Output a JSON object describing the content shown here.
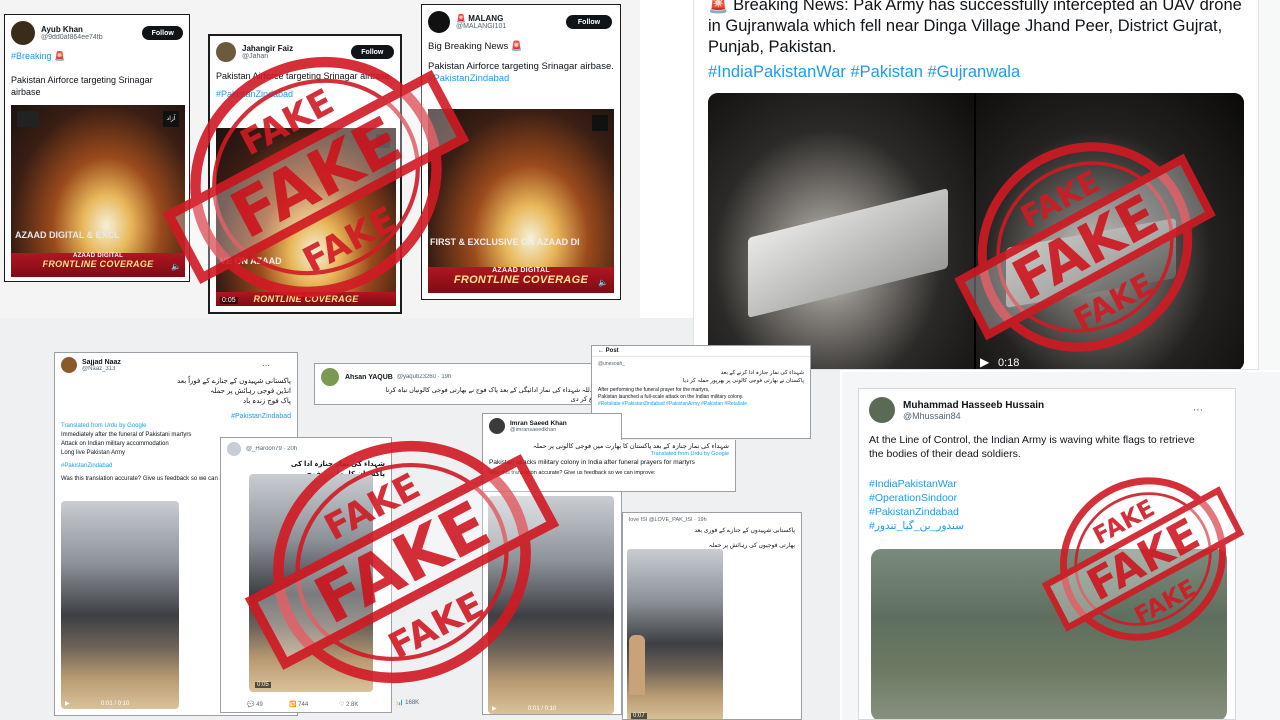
{
  "stamp": {
    "text": "FAKE",
    "color": "#d11a24"
  },
  "colors": {
    "hashtag": "#1d9bf0",
    "text": "#0f1419",
    "muted": "#536471",
    "banner": "#b01622"
  },
  "tweet_ayub": {
    "name": "Ayub Khan",
    "handle": "@9dd0af864ee74fb",
    "follow": "Follow",
    "tag": "#Breaking",
    "emoji": "🚨",
    "text": "Pakistan Airforce targeting Srinagar airbase",
    "banner_title": "AZAAD DIGITAL",
    "banner_sub": "FRONTLINE COVERAGE",
    "overlay": "AZAAD DIGITAL  & EXCL"
  },
  "tweet_jahangir": {
    "name": "Jahangir Faiz",
    "handle": "@Jahan",
    "follow": "Follow",
    "text": "Pakistan Airforce targeting Srinagar airbase.",
    "tag": "#PakistanZindabad",
    "overlay": "VE ON AZAAD",
    "banner_sub": "RONTLINE COVERAGE",
    "time": "0:05"
  },
  "tweet_malang": {
    "name": "MALANG",
    "handle": "@MALANGI101",
    "follow": "Follow",
    "text1": "Big Breaking News",
    "emoji": "🚨",
    "text2": "Pakistan Airforce targeting Srinagar airbase.",
    "tag": "#PakistanZindabad",
    "overlay": "FIRST & EXCLUSIVE ON AZAAD DI",
    "banner_title": "AZAAD DIGITAL",
    "banner_sub": "FRONTLINE COVERAGE"
  },
  "tweet_pakarmy": {
    "line1": "🚨 Breaking News: Pak Army has successfully intercepted an UAV drone",
    "line2": "in Gujranwala which fell near Dinga Village Jhand Peer, District Gujrat,",
    "line3": "Punjab, Pakistan.",
    "tags": "#IndiaPakistanWar #Pakistan #Gujranwala",
    "time": "0:18"
  },
  "tweet_sajjad": {
    "name": "Sajjad Naaz",
    "handle": "@Naaz_313",
    "urdu1": "پاکستانی شہیدوں کے جنازے کے فوراً بعد",
    "urdu2": "انڈین فوجی رہائش پر حملہ",
    "urdu3": "پاک فوج زندہ باد",
    "tag": "#PakistanZindabad",
    "translated": "Translated from Urdu by Google",
    "en1": "Immediately after the funeral of Pakistani martyrs",
    "en2": "Attack on Indian military accommodation",
    "en3": "Long live Pakistan Army",
    "tag2": "#PakistanZindabad",
    "feedback": "Was this translation accurate? Give us feedback so we can im",
    "time": "0:01 / 0:10"
  },
  "tweet_ahsan": {
    "name": "Ahsan YAQUB",
    "handle": "@yaqub23260 · 19h",
    "urdu1": "الحمدللہ شہداء کی نماز ادائیگی کے بعد پاک فوج نے بھارتی فوجی کالونیاں تباہ کرنا",
    "urdu2": "شروع کر دی"
  },
  "tweet_post": {
    "label": "Post",
    "handle": "@unesoah_",
    "urdu1": "شہداء کی نماز جنازہ ادا کرنے کے بعد",
    "urdu2": "پاکستان نے بھارتی فوجی کالونی پر بھرپور حملہ کر دیا",
    "en1": "After performing the funeral prayer for the martyrs,",
    "en2": "Pakistan launched a full-scale attack on the Indian military colony.",
    "tags": "#Retaliate #PakistanZindabad #PakistanArmy #Pakistan #Retaliate"
  },
  "tweet_haroon": {
    "handle": "@_Haroon79 · 20h",
    "urdu1": "شہداء کی نماز جنازہ ادا کی",
    "urdu2": "پاکستان کا بھارتی فوج",
    "time": "0:05",
    "stats": [
      "49",
      "744",
      "2.8K",
      "168K"
    ]
  },
  "tweet_imran": {
    "name": "Imran Saeed Khan",
    "handle": "@imransaeedkhan",
    "urdu": "شہداء کی نماز جنازہ کے بعد پاکستان کا بھارت میں فوجی کالونی پر حملہ",
    "translated": "Translated from Urdu by Google",
    "en": "Pakistan attacks military colony in India after funeral prayers for martyrs",
    "feedback": "Was this translation accurate? Give us feedback so we can improve:",
    "time": "0:01 / 0:10"
  },
  "tweet_love": {
    "handle": "love ISI @LOVE_PAK_ISI · 19h",
    "urdu1": "پاکستانی شہیدوں کے جنازے کے فوری بعد",
    "urdu2": "بھارتی فوجیوں کی رہائش پر حملہ",
    "time": "0:07"
  },
  "tweet_hasseeb": {
    "name": "Muhammad Hasseeb Hussain",
    "handle": "@Mhussain84",
    "text1": "At the Line of Control, the Indian Army is waving white flags to retrieve",
    "text2": "the bodies of their dead soldiers.",
    "tags": [
      "#IndiaPakistanWar",
      "#OperationSindoor",
      "#PakistanZindabad",
      "#سندور_بن_گیا_تندور"
    ]
  }
}
